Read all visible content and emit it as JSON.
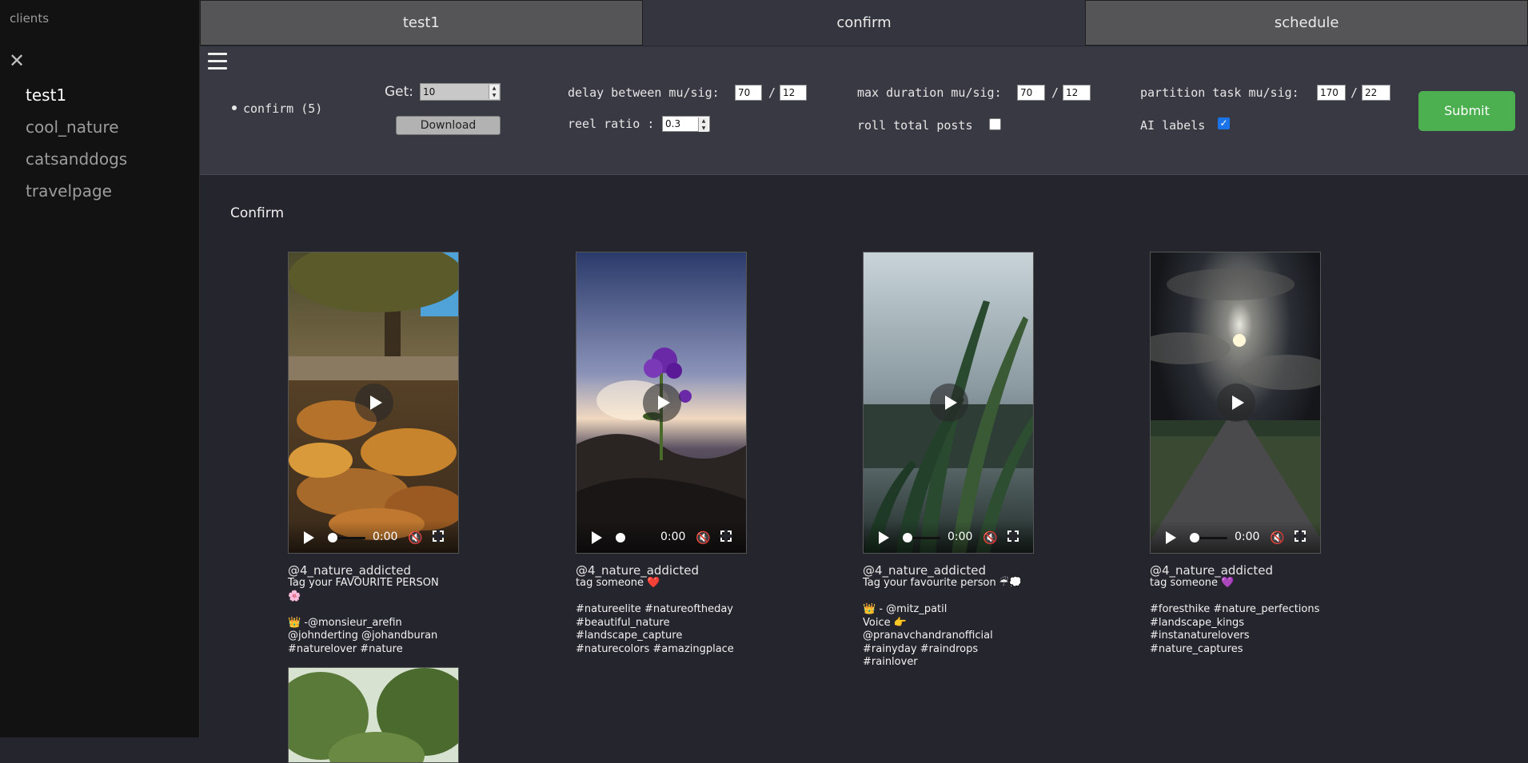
{
  "sidebar": {
    "title": "clients",
    "close_icon": "close-icon",
    "items": [
      "test1",
      "cool_nature",
      "catsanddogs",
      "travelpage"
    ],
    "active": "test1"
  },
  "tabs": [
    "test1",
    "confirm",
    "schedule"
  ],
  "active_tab": "confirm",
  "controls": {
    "menu_icon": "hamburger-icon",
    "bullet_item": "confirm (5)",
    "get_label": "Get:",
    "get_value": "10",
    "download_label": "Download",
    "delay_label": "delay between mu/sig:",
    "delay_mu": "70",
    "delay_sig": "12",
    "reel_ratio_label": "reel ratio :",
    "reel_ratio_value": "0.3",
    "max_duration_label": "max duration mu/sig:",
    "max_duration_mu": "70",
    "max_duration_sig": "12",
    "roll_total_label": "roll total posts",
    "roll_total_checked": false,
    "partition_label": "partition task mu/sig:",
    "partition_mu": "170",
    "partition_sig": "22",
    "ai_labels_label": "AI labels",
    "ai_labels_checked": true,
    "slash": "/",
    "submit_label": "Submit",
    "submit_color": "#4caf50"
  },
  "section_title": "Confirm",
  "posts": [
    {
      "author": "@4_nature_addicted",
      "caption": "Tag your FAVOURITE PERSON\n🌸\n\n👑 -@monsieur_arefin\n@johnderting @johandburan\n#naturelover #nature",
      "time": "0:00"
    },
    {
      "author": "@4_nature_addicted",
      "caption": "tag someone ❤️\n\n#natureelite #natureoftheday\n#beautiful_nature\n#landscape_capture\n#naturecolors #amazingplace",
      "time": "0:00"
    },
    {
      "author": "@4_nature_addicted",
      "caption": "Tag your favourite person ☔💭\n\n👑 - @mitz_patil\nVoice 👉\n@pranavchandranofficial\n#rainyday #raindrops #rainlover",
      "time": "0:00"
    },
    {
      "author": "@4_nature_addicted",
      "caption": "tag someone 💜\n\n#foresthike #nature_perfections\n#landscape_kings\n#instanaturelovers\n#nature_captures",
      "time": "0:00"
    }
  ]
}
